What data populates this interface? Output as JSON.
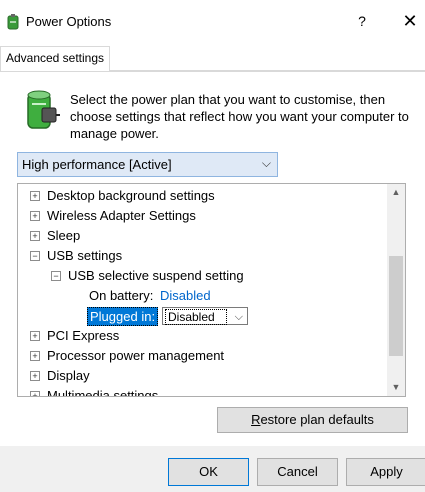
{
  "window": {
    "title": "Power Options",
    "help_glyph": "?",
    "close_glyph": "✕"
  },
  "tabs": [
    {
      "label": "Advanced settings"
    }
  ],
  "intro_text": "Select the power plan that you want to customise, then choose settings that reflect how you want your computer to manage power.",
  "plan_select": {
    "value": "High performance [Active]",
    "arrow": "⌵"
  },
  "tree": {
    "items": [
      {
        "label": "Desktop background settings",
        "expander": "+"
      },
      {
        "label": "Wireless Adapter Settings",
        "expander": "+"
      },
      {
        "label": "Sleep",
        "expander": "+"
      },
      {
        "label": "USB settings",
        "expander": "−"
      },
      {
        "label": "USB selective suspend setting",
        "expander": "−"
      },
      {
        "label": "On battery:",
        "value": "Disabled"
      },
      {
        "label": "Plugged in:",
        "value": "Disabled"
      },
      {
        "label": "PCI Express",
        "expander": "+"
      },
      {
        "label": "Processor power management",
        "expander": "+"
      },
      {
        "label": "Display",
        "expander": "+"
      },
      {
        "label": "Multimedia settings",
        "expander": "+"
      }
    ]
  },
  "buttons": {
    "restore_prefix": "R",
    "restore_rest": "estore plan defaults",
    "ok": "OK",
    "cancel": "Cancel",
    "apply": "Apply"
  },
  "colors": {
    "accent": "#0078d7",
    "link": "#0066cc",
    "button_face": "#e1e1e1"
  },
  "icons": {
    "app": "power-plan-battery-icon",
    "plan": "power-plan-battery-icon"
  }
}
